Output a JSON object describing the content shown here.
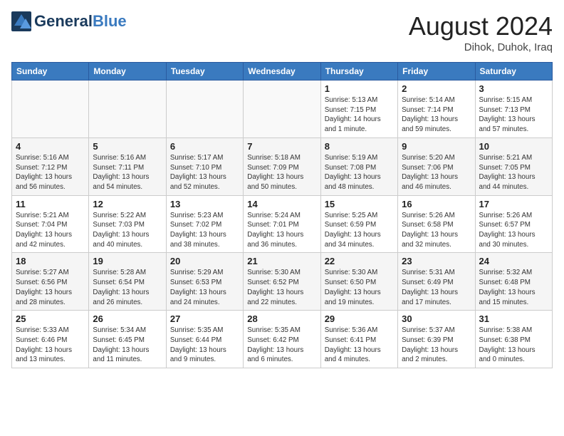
{
  "header": {
    "logo_general": "General",
    "logo_blue": "Blue",
    "month_year": "August 2024",
    "location": "Dihok, Duhok, Iraq"
  },
  "days_of_week": [
    "Sunday",
    "Monday",
    "Tuesday",
    "Wednesday",
    "Thursday",
    "Friday",
    "Saturday"
  ],
  "weeks": [
    [
      {
        "day": "",
        "info": ""
      },
      {
        "day": "",
        "info": ""
      },
      {
        "day": "",
        "info": ""
      },
      {
        "day": "",
        "info": ""
      },
      {
        "day": "1",
        "info": "Sunrise: 5:13 AM\nSunset: 7:15 PM\nDaylight: 14 hours\nand 1 minute."
      },
      {
        "day": "2",
        "info": "Sunrise: 5:14 AM\nSunset: 7:14 PM\nDaylight: 13 hours\nand 59 minutes."
      },
      {
        "day": "3",
        "info": "Sunrise: 5:15 AM\nSunset: 7:13 PM\nDaylight: 13 hours\nand 57 minutes."
      }
    ],
    [
      {
        "day": "4",
        "info": "Sunrise: 5:16 AM\nSunset: 7:12 PM\nDaylight: 13 hours\nand 56 minutes."
      },
      {
        "day": "5",
        "info": "Sunrise: 5:16 AM\nSunset: 7:11 PM\nDaylight: 13 hours\nand 54 minutes."
      },
      {
        "day": "6",
        "info": "Sunrise: 5:17 AM\nSunset: 7:10 PM\nDaylight: 13 hours\nand 52 minutes."
      },
      {
        "day": "7",
        "info": "Sunrise: 5:18 AM\nSunset: 7:09 PM\nDaylight: 13 hours\nand 50 minutes."
      },
      {
        "day": "8",
        "info": "Sunrise: 5:19 AM\nSunset: 7:08 PM\nDaylight: 13 hours\nand 48 minutes."
      },
      {
        "day": "9",
        "info": "Sunrise: 5:20 AM\nSunset: 7:06 PM\nDaylight: 13 hours\nand 46 minutes."
      },
      {
        "day": "10",
        "info": "Sunrise: 5:21 AM\nSunset: 7:05 PM\nDaylight: 13 hours\nand 44 minutes."
      }
    ],
    [
      {
        "day": "11",
        "info": "Sunrise: 5:21 AM\nSunset: 7:04 PM\nDaylight: 13 hours\nand 42 minutes."
      },
      {
        "day": "12",
        "info": "Sunrise: 5:22 AM\nSunset: 7:03 PM\nDaylight: 13 hours\nand 40 minutes."
      },
      {
        "day": "13",
        "info": "Sunrise: 5:23 AM\nSunset: 7:02 PM\nDaylight: 13 hours\nand 38 minutes."
      },
      {
        "day": "14",
        "info": "Sunrise: 5:24 AM\nSunset: 7:01 PM\nDaylight: 13 hours\nand 36 minutes."
      },
      {
        "day": "15",
        "info": "Sunrise: 5:25 AM\nSunset: 6:59 PM\nDaylight: 13 hours\nand 34 minutes."
      },
      {
        "day": "16",
        "info": "Sunrise: 5:26 AM\nSunset: 6:58 PM\nDaylight: 13 hours\nand 32 minutes."
      },
      {
        "day": "17",
        "info": "Sunrise: 5:26 AM\nSunset: 6:57 PM\nDaylight: 13 hours\nand 30 minutes."
      }
    ],
    [
      {
        "day": "18",
        "info": "Sunrise: 5:27 AM\nSunset: 6:56 PM\nDaylight: 13 hours\nand 28 minutes."
      },
      {
        "day": "19",
        "info": "Sunrise: 5:28 AM\nSunset: 6:54 PM\nDaylight: 13 hours\nand 26 minutes."
      },
      {
        "day": "20",
        "info": "Sunrise: 5:29 AM\nSunset: 6:53 PM\nDaylight: 13 hours\nand 24 minutes."
      },
      {
        "day": "21",
        "info": "Sunrise: 5:30 AM\nSunset: 6:52 PM\nDaylight: 13 hours\nand 22 minutes."
      },
      {
        "day": "22",
        "info": "Sunrise: 5:30 AM\nSunset: 6:50 PM\nDaylight: 13 hours\nand 19 minutes."
      },
      {
        "day": "23",
        "info": "Sunrise: 5:31 AM\nSunset: 6:49 PM\nDaylight: 13 hours\nand 17 minutes."
      },
      {
        "day": "24",
        "info": "Sunrise: 5:32 AM\nSunset: 6:48 PM\nDaylight: 13 hours\nand 15 minutes."
      }
    ],
    [
      {
        "day": "25",
        "info": "Sunrise: 5:33 AM\nSunset: 6:46 PM\nDaylight: 13 hours\nand 13 minutes."
      },
      {
        "day": "26",
        "info": "Sunrise: 5:34 AM\nSunset: 6:45 PM\nDaylight: 13 hours\nand 11 minutes."
      },
      {
        "day": "27",
        "info": "Sunrise: 5:35 AM\nSunset: 6:44 PM\nDaylight: 13 hours\nand 9 minutes."
      },
      {
        "day": "28",
        "info": "Sunrise: 5:35 AM\nSunset: 6:42 PM\nDaylight: 13 hours\nand 6 minutes."
      },
      {
        "day": "29",
        "info": "Sunrise: 5:36 AM\nSunset: 6:41 PM\nDaylight: 13 hours\nand 4 minutes."
      },
      {
        "day": "30",
        "info": "Sunrise: 5:37 AM\nSunset: 6:39 PM\nDaylight: 13 hours\nand 2 minutes."
      },
      {
        "day": "31",
        "info": "Sunrise: 5:38 AM\nSunset: 6:38 PM\nDaylight: 13 hours\nand 0 minutes."
      }
    ]
  ]
}
